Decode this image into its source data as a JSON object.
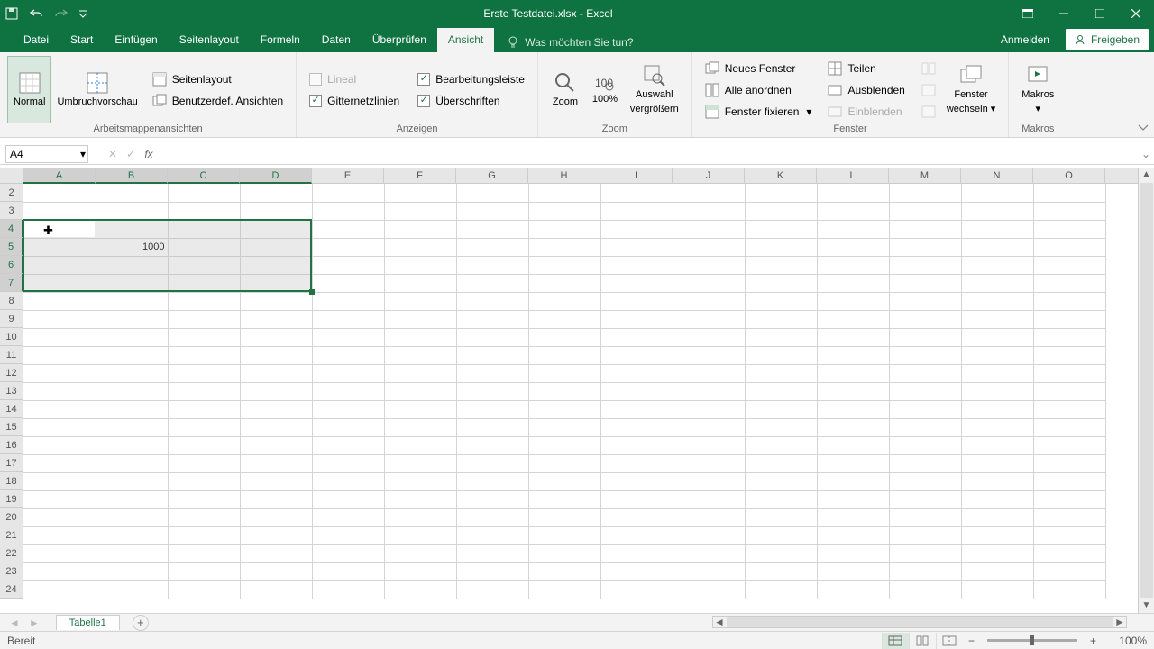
{
  "app": {
    "title": "Erste Testdatei.xlsx - Excel"
  },
  "tabs": {
    "datei": "Datei",
    "start": "Start",
    "einfuegen": "Einfügen",
    "seitenlayout": "Seitenlayout",
    "formeln": "Formeln",
    "daten": "Daten",
    "ueberpruefen": "Überprüfen",
    "ansicht": "Ansicht"
  },
  "tell_me_placeholder": "Was möchten Sie tun?",
  "sign_in": "Anmelden",
  "share": "Freigeben",
  "ribbon": {
    "views": {
      "normal": "Normal",
      "umbruch": "Umbruchvorschau",
      "seitenlayout": "Seitenlayout",
      "benutzerdef": "Benutzerdef. Ansichten",
      "group": "Arbeitsmappenansichten"
    },
    "show": {
      "lineal": "Lineal",
      "bearbeitungsleiste": "Bearbeitungsleiste",
      "gitternetz": "Gitternetzlinien",
      "ueberschriften": "Überschriften",
      "group": "Anzeigen"
    },
    "zoom": {
      "zoom": "Zoom",
      "p100": "100%",
      "auswahl1": "Auswahl",
      "auswahl2": "vergrößern",
      "group": "Zoom"
    },
    "window": {
      "neues": "Neues Fenster",
      "alle": "Alle anordnen",
      "fixieren": "Fenster fixieren",
      "teilen": "Teilen",
      "ausblenden": "Ausblenden",
      "einblenden": "Einblenden",
      "wechseln1": "Fenster",
      "wechseln2": "wechseln",
      "group": "Fenster"
    },
    "macros": {
      "makros": "Makros",
      "group": "Makros"
    }
  },
  "namebox": "A4",
  "formula": "",
  "columns": [
    "A",
    "B",
    "C",
    "D",
    "E",
    "F",
    "G",
    "H",
    "I",
    "J",
    "K",
    "L",
    "M",
    "N",
    "O"
  ],
  "rows": [
    "2",
    "3",
    "4",
    "5",
    "6",
    "7",
    "8",
    "9",
    "10",
    "11",
    "12",
    "13",
    "14",
    "15",
    "16",
    "17",
    "18",
    "19",
    "20",
    "21",
    "22",
    "23",
    "24"
  ],
  "selected_cols": [
    "A",
    "B",
    "C",
    "D"
  ],
  "selected_rows": [
    "4",
    "5",
    "6",
    "7"
  ],
  "active_cell": "A4",
  "cells": {
    "B5": "1000"
  },
  "sheet": {
    "name": "Tabelle1"
  },
  "status": {
    "ready": "Bereit",
    "zoom": "100%"
  },
  "colors": {
    "brand": "#217346",
    "brand_dark": "#0e7241"
  }
}
